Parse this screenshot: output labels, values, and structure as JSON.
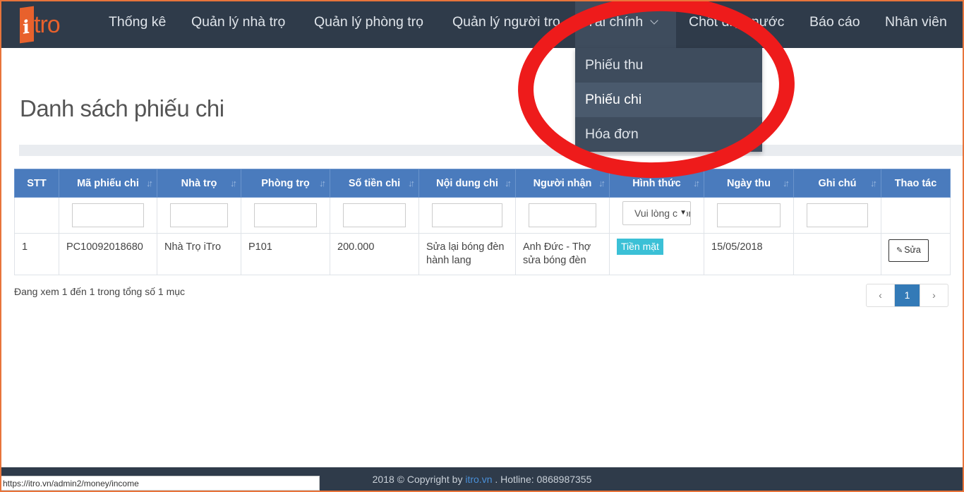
{
  "nav": {
    "logo_letter": "i",
    "logo_text": "tro",
    "items": [
      "Thống kê",
      "Quản lý nhà trọ",
      "Quản lý phòng trọ",
      "Quản lý người trọ",
      "Tài chính",
      "Chốt điện nước",
      "Báo cáo",
      "Nhân viên"
    ],
    "dropdown": [
      "Phiếu thu",
      "Phiếu chi",
      "Hóa đơn"
    ]
  },
  "page": {
    "title": "Danh sách phiếu chi"
  },
  "table": {
    "headers": [
      "STT",
      "Mã phiếu chi",
      "Nhà trọ",
      "Phòng trọ",
      "Số tiền chi",
      "Nội dung chi",
      "Người nhận",
      "Hình thức",
      "Ngày thu",
      "Ghi chú",
      "Thao tác"
    ],
    "select_placeholder": "Vui lòng chọn",
    "rows": [
      {
        "stt": "1",
        "ma": "PC10092018680",
        "nha_tro": "Nhà Trọ iTro",
        "phong": "P101",
        "so_tien": "200.000",
        "noi_dung": "Sửa lại bóng đèn hành lang",
        "nguoi_nhan": "Anh Đức - Thợ sửa bóng đèn",
        "hinh_thuc": "Tiền mặt",
        "ngay": "15/05/2018",
        "ghi_chu": "",
        "action": "Sửa"
      }
    ]
  },
  "info_text": "Đang xem 1 đến 1 trong tổng số 1 mục",
  "pagination": {
    "prev": "‹",
    "current": "1",
    "next": "›"
  },
  "footer": {
    "prefix": "2018 © Copyright by ",
    "link": "itro.vn",
    "suffix": " . Hotline: 0868987355"
  },
  "status_url": "https://itro.vn/admin2/money/income",
  "colors": {
    "navbar": "#2f3b4a",
    "table_header": "#4a7bbd",
    "badge": "#3bc0d6",
    "annotation": "#ee1b1b",
    "brand": "#e8612c"
  }
}
